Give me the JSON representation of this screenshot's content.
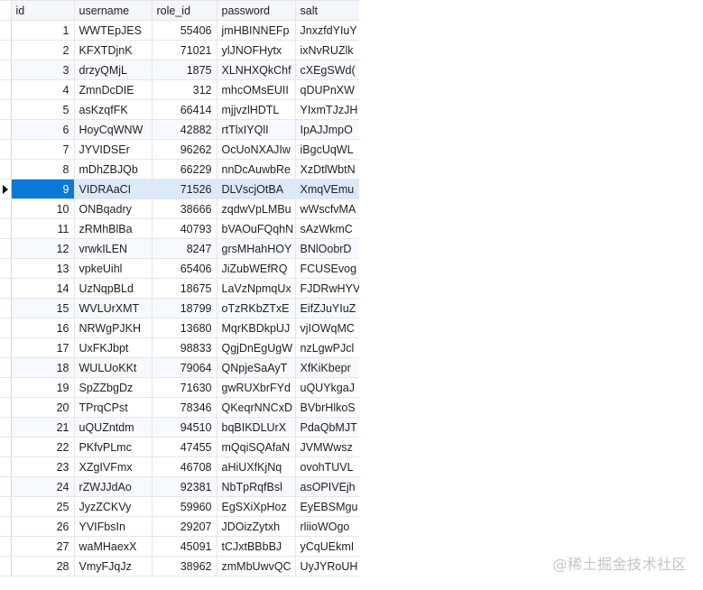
{
  "table": {
    "columns": [
      "id",
      "username",
      "role_id",
      "password",
      "salt"
    ],
    "selected_row_index": 8,
    "rows": [
      {
        "id": "1",
        "username": "WWTEpJES",
        "role_id": "55406",
        "password": "jmHBINNEFp",
        "salt": "JnxzfdYIuY"
      },
      {
        "id": "2",
        "username": "KFXTDjnK",
        "role_id": "71021",
        "password": "ylJNOFHytx",
        "salt": "ixNvRUZlk"
      },
      {
        "id": "3",
        "username": "drzyQMjL",
        "role_id": "1875",
        "password": "XLNHXQkChf",
        "salt": "cXEgSWd("
      },
      {
        "id": "4",
        "username": "ZmnDcDIE",
        "role_id": "312",
        "password": "mhcOMsEUII",
        "salt": "qDUPnXW"
      },
      {
        "id": "5",
        "username": "asKzqfFK",
        "role_id": "66414",
        "password": "mjjvzlHDTL",
        "salt": "YIxmTJzJH"
      },
      {
        "id": "6",
        "username": "HoyCqWNW",
        "role_id": "42882",
        "password": "rtTlxIYQlI",
        "salt": "IpAJJmpO"
      },
      {
        "id": "7",
        "username": "JYVIDSEr",
        "role_id": "96262",
        "password": "OcUoNXAJIw",
        "salt": "iBgcUqWL"
      },
      {
        "id": "8",
        "username": "mDhZBJQb",
        "role_id": "66229",
        "password": "nnDcAuwbRe",
        "salt": "XzDtlWbtN"
      },
      {
        "id": "9",
        "username": "VIDRAaCI",
        "role_id": "71526",
        "password": "DLVscjOtBA",
        "salt": "XmqVEmu"
      },
      {
        "id": "10",
        "username": "ONBqadry",
        "role_id": "38666",
        "password": "zqdwVpLMBu",
        "salt": "wWscfvMA"
      },
      {
        "id": "11",
        "username": "zRMhBlBa",
        "role_id": "40793",
        "password": "bVAOuFQqhN",
        "salt": "sAzWkmC"
      },
      {
        "id": "12",
        "username": "vrwkILEN",
        "role_id": "8247",
        "password": "grsMHahHOY",
        "salt": "BNlOobrD"
      },
      {
        "id": "13",
        "username": "vpkeUihl",
        "role_id": "65406",
        "password": "JiZubWEfRQ",
        "salt": "FCUSEvog"
      },
      {
        "id": "14",
        "username": "UzNqpBLd",
        "role_id": "18675",
        "password": "LaVzNpmqUx",
        "salt": "FJDRwHYV"
      },
      {
        "id": "15",
        "username": "WVLUrXMT",
        "role_id": "18799",
        "password": "oTzRKbZTxE",
        "salt": "EifZJuYIuZ"
      },
      {
        "id": "16",
        "username": "NRWgPJKH",
        "role_id": "13680",
        "password": "MqrKBDkpUJ",
        "salt": "vjIOWqMC"
      },
      {
        "id": "17",
        "username": "UxFKJbpt",
        "role_id": "98833",
        "password": "QgjDnEgUgW",
        "salt": "nzLgwPJcl"
      },
      {
        "id": "18",
        "username": "WULUoKKt",
        "role_id": "79064",
        "password": "QNpjeSaAyT",
        "salt": "XfKiKbepr"
      },
      {
        "id": "19",
        "username": "SpZZbgDz",
        "role_id": "71630",
        "password": "gwRUXbrFYd",
        "salt": "uQUYkgaJ"
      },
      {
        "id": "20",
        "username": "TPrqCPst",
        "role_id": "78346",
        "password": "QKeqrNNCxD",
        "salt": "BVbrHlkoS"
      },
      {
        "id": "21",
        "username": "uQUZntdm",
        "role_id": "94510",
        "password": "bqBIKDLUrX",
        "salt": "PdaQbMJT"
      },
      {
        "id": "22",
        "username": "PKfvPLmc",
        "role_id": "47455",
        "password": "mQqiSQAfaN",
        "salt": "JVMWwsz"
      },
      {
        "id": "23",
        "username": "XZgIVFmx",
        "role_id": "46708",
        "password": "aHiUXfKjNq",
        "salt": "ovohTUVL"
      },
      {
        "id": "24",
        "username": "rZWJJdAo",
        "role_id": "92381",
        "password": "NbTpRqfBsl",
        "salt": "asOPIVEjh"
      },
      {
        "id": "25",
        "username": "JyzZCKVy",
        "role_id": "59960",
        "password": "EgSXiXpHoz",
        "salt": "EyEBSMgu"
      },
      {
        "id": "26",
        "username": "YVIFbsIn",
        "role_id": "29207",
        "password": "JDOizZytxh",
        "salt": "rliioWOgo"
      },
      {
        "id": "27",
        "username": "waMHaexX",
        "role_id": "45091",
        "password": "tCJxtBBbBJ",
        "salt": "yCqUEkmI"
      },
      {
        "id": "28",
        "username": "VmyFJqJz",
        "role_id": "38962",
        "password": "zmMbUwvQC",
        "salt": "UyJYRoUH"
      }
    ]
  },
  "icons": {
    "row_indicator": "current-row-arrow-icon"
  },
  "watermark": "@稀土掘金技术社区"
}
